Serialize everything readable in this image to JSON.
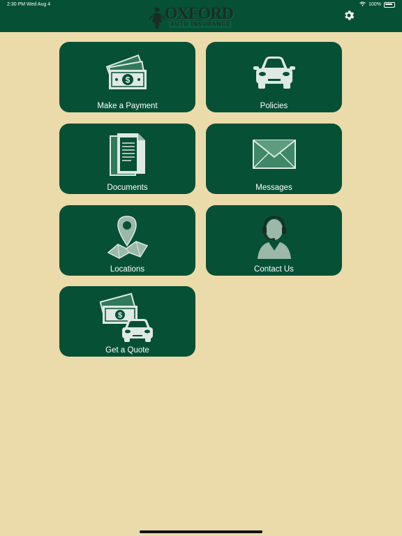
{
  "status_bar": {
    "time_date": "2:30 PM   Wed Aug 4",
    "battery": "100%"
  },
  "header": {
    "logo_text_top": "OXFORD",
    "logo_text_bottom": "AUTO INSURANCE",
    "settings_icon": "gear-icon"
  },
  "colors": {
    "background": "#ecdbaa",
    "brand_green": "#065036",
    "tile_text": "#ffffff"
  },
  "tiles": [
    {
      "label": "Make a Payment",
      "icon": "cash-icon"
    },
    {
      "label": "Policies",
      "icon": "car-icon"
    },
    {
      "label": "Documents",
      "icon": "documents-icon"
    },
    {
      "label": "Messages",
      "icon": "envelope-icon"
    },
    {
      "label": "Locations",
      "icon": "map-pin-icon"
    },
    {
      "label": "Contact Us",
      "icon": "headset-agent-icon"
    },
    {
      "label": "Get a Quote",
      "icon": "quote-cash-car-icon"
    }
  ]
}
